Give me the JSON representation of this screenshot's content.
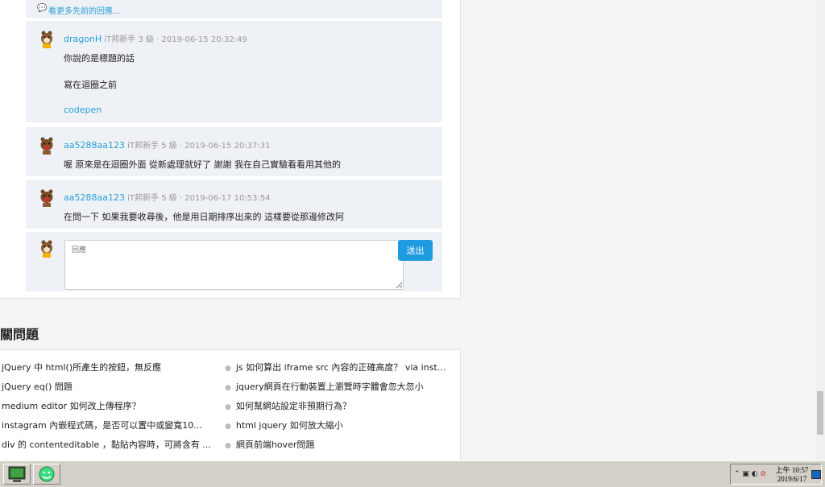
{
  "thread": {
    "more_replies": "看更多先前的回應...",
    "comments": [
      {
        "user": "dragonH",
        "meta": "iT邦新手 3 級 · 2019-06-15 20:32:49",
        "lines": [
          "你說的是標題的話",
          "寫在迴圈之前",
          "codepen"
        ]
      },
      {
        "user": "aa5288aa123",
        "meta": "iT邦新手 5 級 · 2019-06-15 20:37:31",
        "lines": [
          "喔 原來是在迴圈外面 從新處理就好了 謝謝 我在自己實驗看看用其他的"
        ]
      },
      {
        "user": "aa5288aa123",
        "meta": "iT邦新手 5 級 · 2019-06-17 10:53:54",
        "lines": [
          "在問一下 如果我要收尋後，他是用日期排序出來的 這樣要從那邊修改阿"
        ]
      }
    ],
    "reply_placeholder": "回應",
    "send_label": "送出"
  },
  "related": {
    "title": "關問題",
    "left": [
      "jQuery 中 html()所產生的按鈕，無反應",
      "jQuery eq() 問題",
      "medium editor 如何改上傳程序？",
      "instagram 內嵌程式碼，是否可以置中或變寬10...",
      "div 的 contenteditable ，黏貼內容時，可將含有 ..."
    ],
    "right": [
      "js 如何算出 iframe src 內容的正確高度？ via inst...",
      "jquery網頁在行動裝置上瀏覽時字體會忽大忽小",
      "如何幫網站設定非預期行為？",
      "html jquery 如何放大縮小",
      "網頁前端hover問題"
    ]
  },
  "taskbar": {
    "time": "上午 10:57",
    "date": "2019/6/17"
  }
}
